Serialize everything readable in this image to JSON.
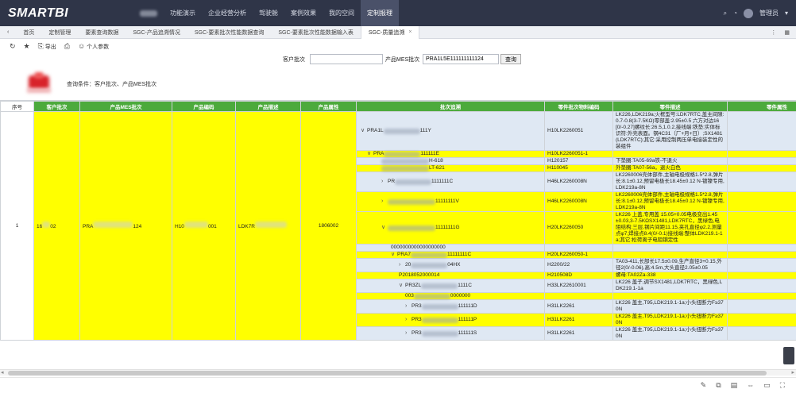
{
  "header": {
    "logo": "SMARTBI",
    "nav": [
      "功能演示",
      "企业经营分析",
      "驾驶舱",
      "案例效果",
      "我的空间",
      "定制报理"
    ],
    "user": "管理员"
  },
  "tabs": [
    "首页",
    "定制管理",
    "要素查询数据",
    "SGC-产品追溯情况",
    "SGC-要素批次性能数据查询",
    "SGC-要素批次性能数据输入表",
    "SGC-质量追溯"
  ],
  "toolbar": {
    "export": "导出",
    "params": "个人参数"
  },
  "filters": {
    "customer_label": "客户批次",
    "customer_value": "",
    "mes_label": "产品MES批次",
    "mes_value": "PRA1L5E111111111124",
    "query": "查询"
  },
  "condition_text": "查询条件：客户批次、产品MES批次",
  "columns": [
    "序号",
    "客户批次",
    "产品MES批次",
    "产品编码",
    "产品描述",
    "产品属性",
    "批次追溯",
    "零件批次物料编码",
    "零件描述",
    "零件属性"
  ],
  "summary": {
    "idx": "1",
    "customer_a": "16",
    "customer_b": "02",
    "mes_a": "PRA",
    "mes_b": "124",
    "code_a": "H10",
    "code_b": "001",
    "desc_a": "LDK7R",
    "attr": "1806002"
  },
  "tree": {
    "rows": [
      {
        "lvl": "lv0",
        "arrow": "∨",
        "a": "PRA1L",
        "b": "111Y",
        "part": "H10LK2260051",
        "desc": "LK226,LDK219a;火框型号:LDK7RTC,盖主间隙:0.7-0.8(3-7.5KΩ)零部盖:2.95±0.5 六方对边16[0/-0.27]螺纹长:26.5,1.0.2,接线端:铁垫;实体标识符:外壳表面。钢4C31（厂+月+日）;SX1481(LDK7RTC);其它:采用控制两压单电接装定性的装组件",
        "color": "blue"
      },
      {
        "lvl": "lv1",
        "arrow": "∨",
        "a": "PRA",
        "b": "111111E",
        "part": "H10LK2260051-1",
        "desc": "",
        "color": "yellow"
      },
      {
        "lvl": "lv2",
        "arrow": "",
        "a": "",
        "b": "H-618",
        "part": "H120157",
        "desc": "下垫圈:TA05-69a铁-不退火",
        "color": "blue"
      },
      {
        "lvl": "lv2",
        "arrow": "",
        "a": "",
        "b": "LT-621",
        "part": "H110045",
        "desc": "外垫圈:TA07-56a，退火白色",
        "color": "yellow"
      },
      {
        "lvl": "lv2",
        "arrow": "›",
        "a": "PR",
        "b": "1111111C",
        "part": "H46LK2260008N",
        "desc": "LK2260006壳体部件,主轴电极规格1.5*2.8,弹片长:8.1±0.12,预留电极长18.45±0.12 N-镀镍专用,LDK219a-8N",
        "color": "blue"
      },
      {
        "lvl": "lv2",
        "arrow": "›",
        "a": "",
        "b": "11111111V",
        "part": "H46LK2260008N",
        "desc": "LK2260006壳体部件,主轴电极规格1.5*2.8,弹片长:8.1±0.12,预留电极长18.45±0.12 N-镀镍专用,LDK219a-8N",
        "color": "yellow"
      },
      {
        "lvl": "lv2",
        "arrow": "∨",
        "a": "",
        "b": "11111111G",
        "part": "H20LK2260050",
        "desc": "LK226 上盖,专用盖 15.05+0.05电极变出1.45±0.03,3-7.5KΩSX1481,LDK7RTC，黑绿色,电阻结构:三层,钢片间距11.15,夹孔直径φ2.2,测量点φ7,焊接点8.4(0/-0.1)接线端:整体LDK219.1-1a;其它:松荷离子电阻钢定性",
        "color": "yellow"
      },
      {
        "lvl": "lv3",
        "arrow": "",
        "a": "0000000000000000000",
        "b": "",
        "part": "",
        "desc": "",
        "color": "blue"
      },
      {
        "lvl": "lv3",
        "arrow": "∨",
        "a": "PRA7",
        "b": "11111111C",
        "part": "H20LK2260050-1",
        "desc": "",
        "color": "yellow"
      },
      {
        "lvl": "lv4",
        "arrow": "›",
        "a": "20",
        "b": "04HX",
        "part": "H2200/22",
        "desc": "TA03-411,长部长17.5±0.09,生产直径3+0.15,外径2(0/-0.06),高:4.5m,大头直径2.05±0.05",
        "color": "blue"
      },
      {
        "lvl": "lv4",
        "arrow": "",
        "a": "P2018052000014",
        "b": "",
        "part": "H210508D",
        "desc": "螺母:TA02Za-338",
        "color": "yellow"
      },
      {
        "lvl": "lv4",
        "arrow": "∨",
        "a": "PR3ZL",
        "b": "1111C",
        "part": "H33LK22610001",
        "desc": "LK226 盖子,调节SX1481,LDK7RTC，黑绿色,LDK219.1-1a",
        "color": "blue"
      },
      {
        "lvl": "lv5",
        "arrow": "",
        "a": "003",
        "b": "0000000",
        "part": "",
        "desc": "",
        "color": "yellow"
      },
      {
        "lvl": "lv5",
        "arrow": "›",
        "a": "PR3",
        "b": "111111D",
        "part": "H31LK2261",
        "desc": "LK226 盖主,T95,LDK219.1-1a;小头扭断力F≥370N",
        "color": "blue"
      },
      {
        "lvl": "lv5",
        "arrow": "›",
        "a": "PR3",
        "b": "111111P",
        "part": "H31LK2261",
        "desc": "LK226 盖主,T95,LDK219.1-1a;小头扭断力F≥370N",
        "color": "yellow"
      },
      {
        "lvl": "lv5",
        "arrow": "›",
        "a": "PR3",
        "b": "111111S",
        "part": "H31LK2261",
        "desc": "LK226 盖主,T95,LDK219.1-1a;小头扭断力F≥370N",
        "color": "blue"
      }
    ]
  }
}
